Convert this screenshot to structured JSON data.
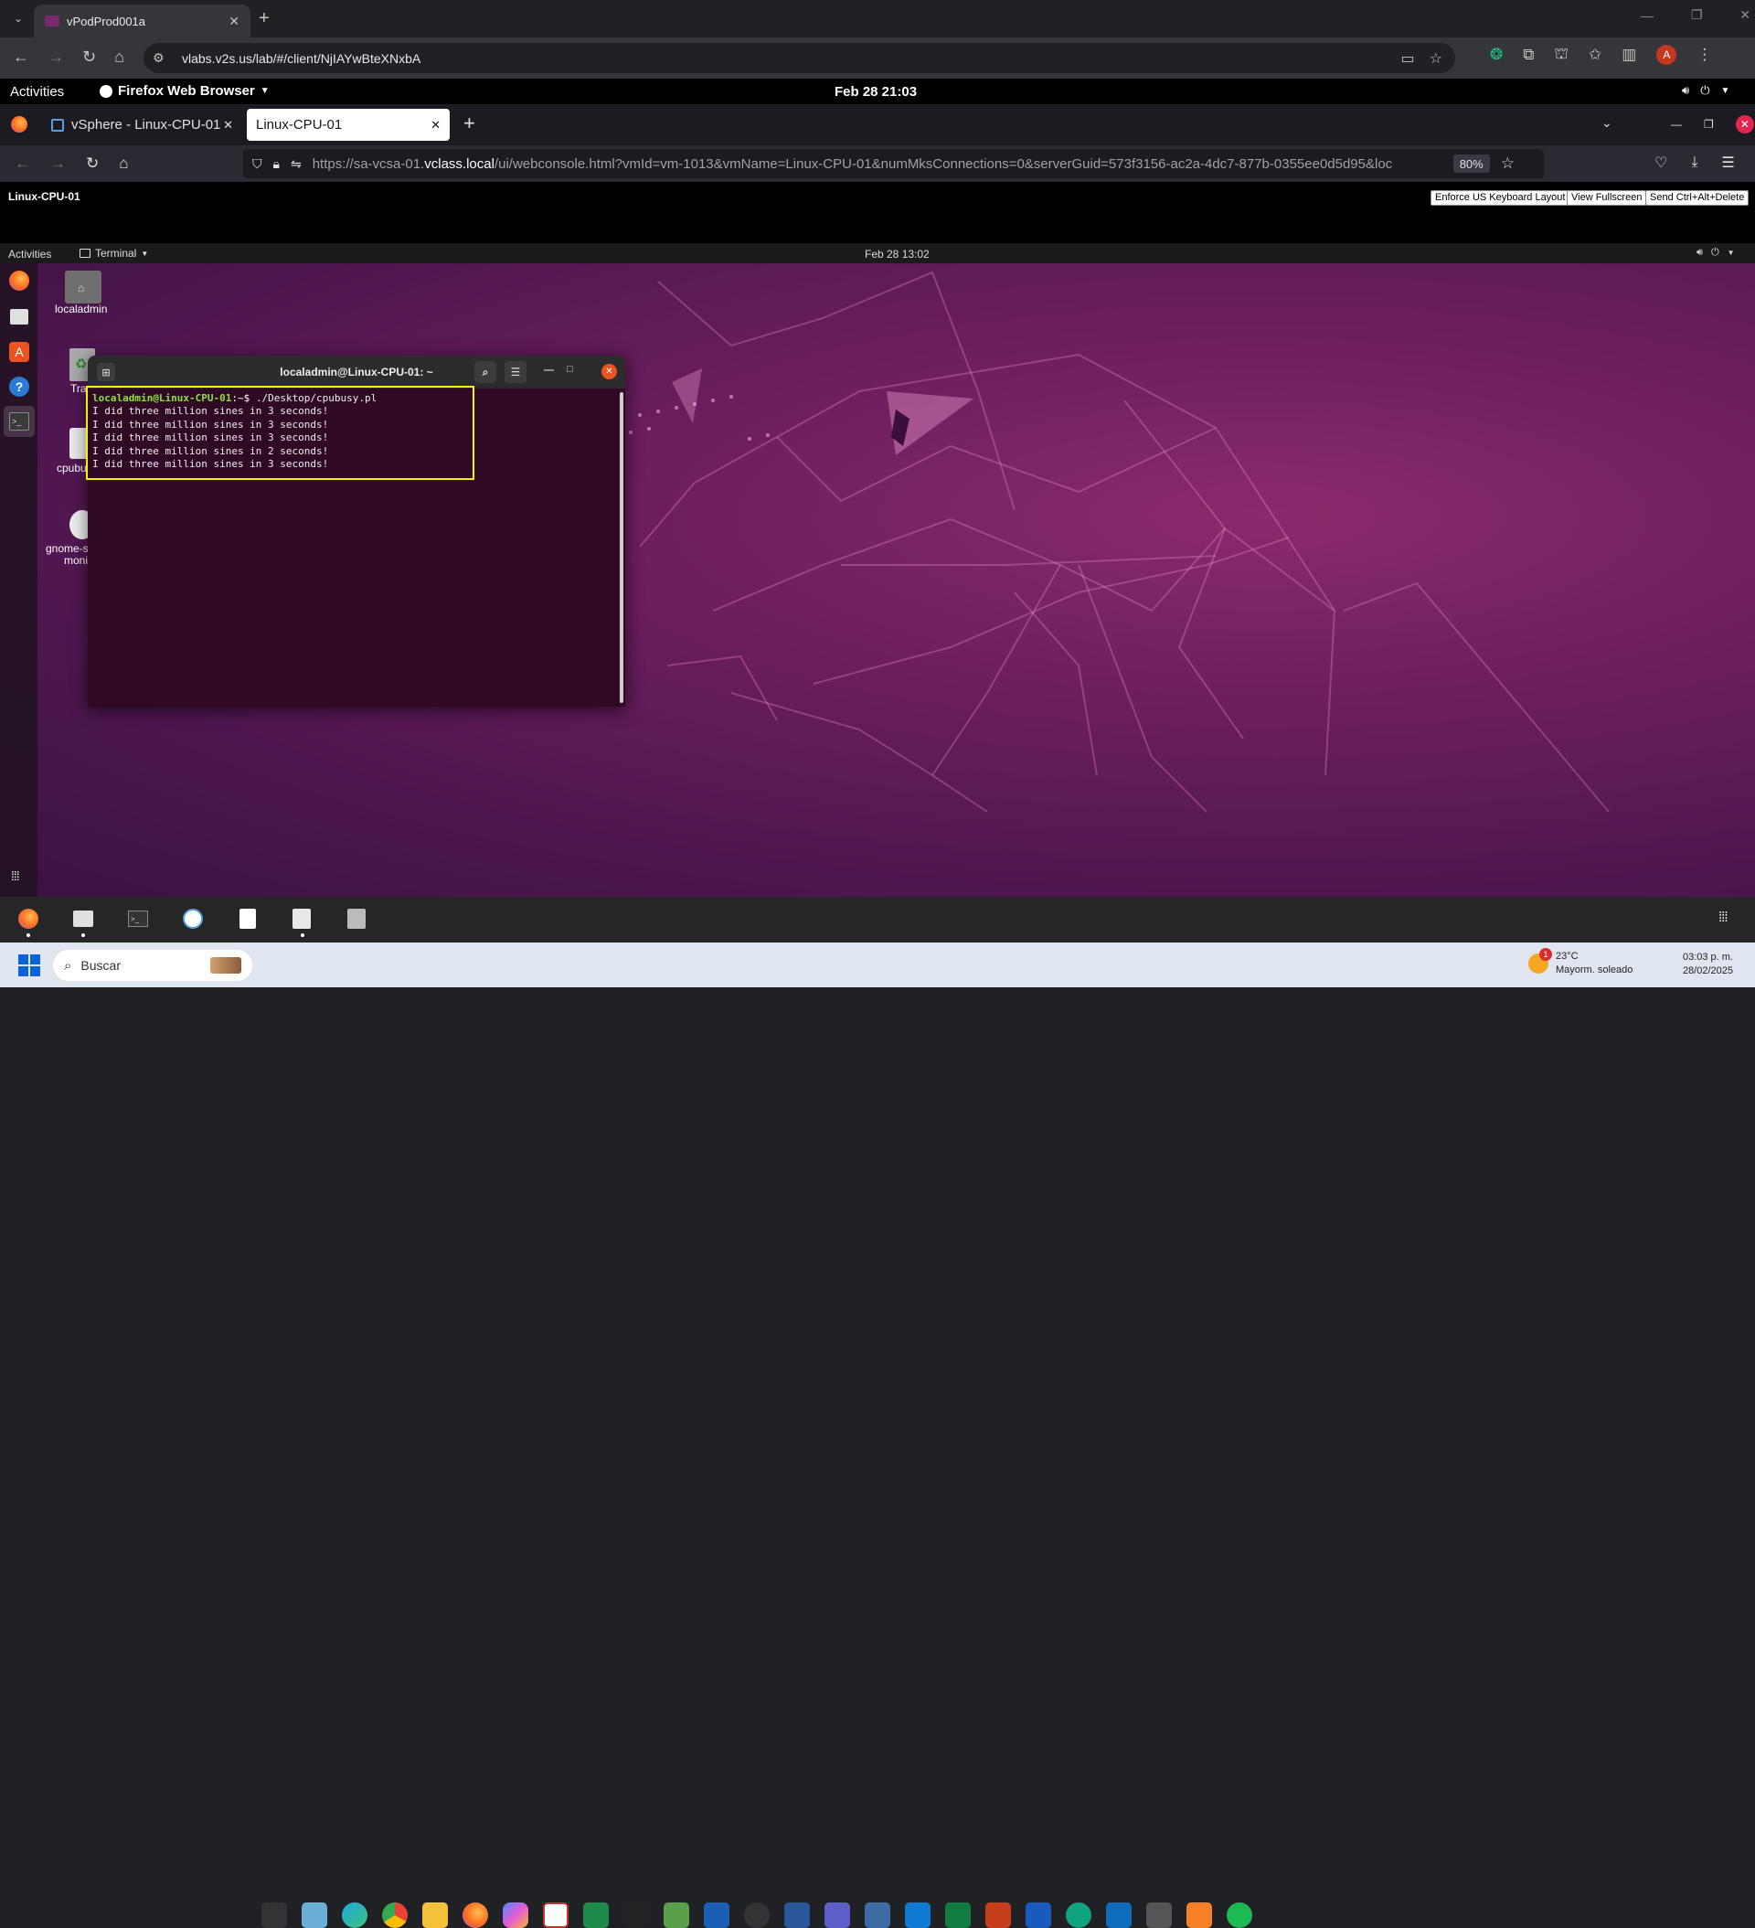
{
  "chrome": {
    "tab_title": "vPodProd001a",
    "address": "vlabs.v2s.us/lab/#/client/NjIAYwBteXNxbA",
    "profile_initial": "A"
  },
  "gnome_host": {
    "activities": "Activities",
    "app_menu": "Firefox Web Browser",
    "clock": "Feb 28  21:03"
  },
  "firefox": {
    "tabs": [
      {
        "label": "vSphere - Linux-CPU-01"
      },
      {
        "label": "Linux-CPU-01"
      }
    ],
    "url_prefix": "https://sa-vcsa-01.",
    "url_domain": "vclass.local",
    "url_rest": "/ui/webconsole.html?vmId=vm-1013&vmName=Linux-CPU-01&numMksConnections=0&serverGuid=573f3156-ac2a-4dc7-877b-0355ee0d5d95&loc",
    "zoom": "80%"
  },
  "console": {
    "vm_name": "Linux-CPU-01",
    "btn_keyboard": "Enforce US Keyboard Layout",
    "btn_fullscreen": "View Fullscreen",
    "btn_cad": "Send Ctrl+Alt+Delete"
  },
  "guest": {
    "activities": "Activities",
    "app_menu": "Terminal",
    "clock": "Feb 28  13:02",
    "desktop_icons": [
      {
        "label": "localadmin"
      },
      {
        "label": "Tra"
      },
      {
        "label": "cpubu"
      },
      {
        "label": "gnome-sy"
      },
      {
        "label": "moni"
      }
    ]
  },
  "terminal": {
    "title": "localadmin@Linux-CPU-01: ~",
    "prompt_user": "localadmin@Linux-CPU-01",
    "prompt_path": ":~$ ",
    "command": "./Desktop/cpubusy.pl",
    "output": [
      "I did three million sines in 3 seconds!",
      "I did three million sines in 3 seconds!",
      "I did three million sines in 3 seconds!",
      "I did three million sines in 2 seconds!",
      "I did three million sines in 3 seconds!"
    ]
  },
  "taskbar": {
    "search_placeholder": "Buscar",
    "weather_temp": "23°C",
    "weather_desc": "Mayorm. soleado",
    "weather_badge": "1",
    "time": "03:03 p. m.",
    "date": "28/02/2025"
  },
  "colors": {
    "highlight": "#f5f500",
    "prompt_green": "#8ae234",
    "prompt_blue": "#729fcf",
    "terminal_bg": "#300a24"
  }
}
